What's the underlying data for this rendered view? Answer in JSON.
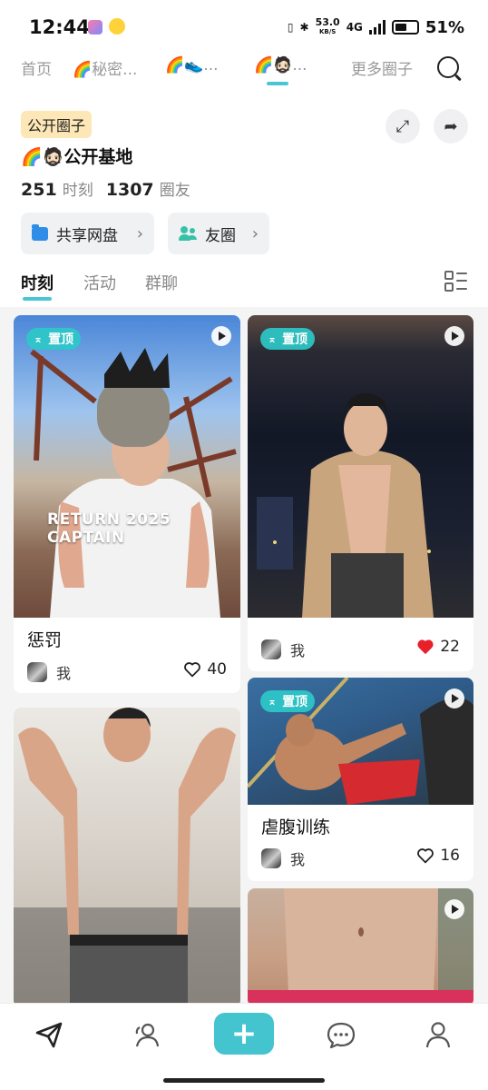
{
  "status_bar": {
    "time": "12:44",
    "net_speed": "53.0",
    "net_unit": "KB/S",
    "network": "4G",
    "battery": "51%"
  },
  "top_nav": {
    "tabs": [
      {
        "label": "首页"
      },
      {
        "label": "🌈秘密..."
      },
      {
        "label": "🌈👟..."
      },
      {
        "label": "🌈🧔🏻..."
      },
      {
        "label": "更多圈子"
      }
    ],
    "active_index": 3
  },
  "circle": {
    "badge": "公开圈子",
    "title": "🌈🧔🏻公开基地",
    "moments_count": "251",
    "moments_label": "时刻",
    "members_count": "1307",
    "members_label": "圈友",
    "shared_drive_label": "共享网盘",
    "friends_label": "友圈"
  },
  "content_tabs": [
    {
      "label": "时刻"
    },
    {
      "label": "活动"
    },
    {
      "label": "群聊"
    }
  ],
  "feed": [
    {
      "title": "惩罚",
      "author": "我",
      "likes": "40",
      "liked": false,
      "pinned": true,
      "pin_label": "置顶",
      "overlay_text": "RETURN 2025 CAPTAIN"
    },
    {
      "title": "",
      "author": "我",
      "likes": "22",
      "liked": true,
      "pinned": true,
      "pin_label": "置顶"
    },
    {
      "title": "虐腹训练",
      "author": "我",
      "likes": "16",
      "liked": false,
      "pinned": true,
      "pin_label": "置顶"
    },
    {
      "title": "",
      "author": "",
      "likes": "",
      "liked": false,
      "pinned": false
    },
    {
      "title": "",
      "author": "",
      "likes": "",
      "liked": false,
      "pinned": false
    }
  ],
  "colors": {
    "accent": "#43c4cf",
    "pin_badge": "#2dc8c8",
    "heart_liked": "#e8202a",
    "badge_bg": "#fde7b7"
  },
  "bottom_nav": {
    "icons": [
      "paper-plane-icon",
      "friends-icon",
      "add-icon",
      "chat-icon",
      "profile-icon"
    ],
    "add_label": "+"
  }
}
